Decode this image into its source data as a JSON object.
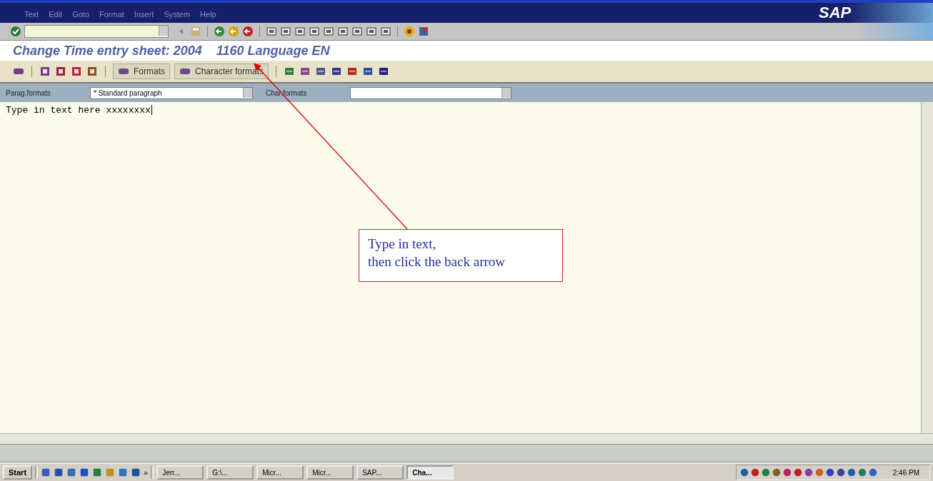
{
  "menu_bar": {
    "items": [
      "Text",
      "Edit",
      "Goto",
      "Format",
      "Insert",
      "System",
      "Help"
    ],
    "logo": "SAP"
  },
  "title_parts": [
    "Change Time entry sheet: 2004",
    "1160 Language EN"
  ],
  "app_toolbar": {
    "buttons": [
      "Formats",
      "Character formats"
    ]
  },
  "format_bar": {
    "paragraph_label": "Parag.formats",
    "paragraph_value": "* Standard paragraph",
    "char_label": "Char.formats"
  },
  "editor": {
    "text": "Type in text here xxxxxxxx"
  },
  "callout": {
    "lines": [
      "Type in text,",
      "then click the back arrow"
    ]
  },
  "taskbar": {
    "start": "Start",
    "more": "»",
    "tasks": [
      {
        "label": "Jerr...",
        "selected": false
      },
      {
        "label": "G:\\...",
        "selected": false
      },
      {
        "label": "Micr...",
        "selected": false
      },
      {
        "label": "Micr...",
        "selected": false
      },
      {
        "label": "SAP...",
        "selected": false
      },
      {
        "label": "Cha...",
        "selected": true
      }
    ],
    "clock": "2:46 PM"
  }
}
